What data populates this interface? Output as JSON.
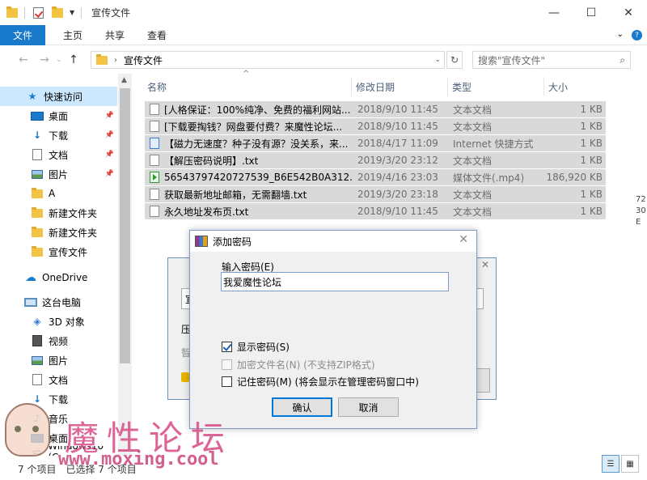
{
  "window": {
    "title": "宣传文件",
    "controls": [
      "—",
      "☐",
      "✕"
    ]
  },
  "ribbon": {
    "tabs": [
      "文件",
      "主页",
      "共享",
      "查看"
    ]
  },
  "address": {
    "path": "宣传文件",
    "search_placeholder": "搜索\"宣传文件\""
  },
  "sidebar": {
    "items": [
      {
        "label": "快速访问",
        "icon": "star-icon"
      },
      {
        "label": "桌面",
        "icon": "desktop-icon",
        "pinned": true
      },
      {
        "label": "下载",
        "icon": "download-icon",
        "pinned": true
      },
      {
        "label": "文档",
        "icon": "document-icon",
        "pinned": true
      },
      {
        "label": "图片",
        "icon": "picture-icon",
        "pinned": true
      },
      {
        "label": "A",
        "icon": "folder-icon"
      },
      {
        "label": "新建文件夹",
        "icon": "folder-icon"
      },
      {
        "label": "新建文件夹",
        "icon": "folder-icon"
      },
      {
        "label": "宣传文件",
        "icon": "folder-icon"
      },
      {
        "label": "OneDrive",
        "icon": "cloud-icon"
      },
      {
        "label": "这台电脑",
        "icon": "pc-icon"
      },
      {
        "label": "3D 对象",
        "icon": "3d-object-icon"
      },
      {
        "label": "视频",
        "icon": "video-icon"
      },
      {
        "label": "图片",
        "icon": "picture-icon"
      },
      {
        "label": "文档",
        "icon": "document-icon"
      },
      {
        "label": "下载",
        "icon": "download-icon"
      },
      {
        "label": "音乐",
        "icon": "music-icon"
      },
      {
        "label": "桌面",
        "icon": "desktop-icon"
      },
      {
        "label": "Windows10 (C:",
        "icon": "drive-icon"
      }
    ]
  },
  "file_list": {
    "columns": [
      "名称",
      "修改日期",
      "类型",
      "大小"
    ],
    "rows": [
      {
        "name": "[人格保证：100%纯净、免费的福利网站...",
        "date": "2018/9/10 11:45",
        "type": "文本文档",
        "size": "1 KB",
        "icon": "text-file-icon"
      },
      {
        "name": "[下载要掏钱？网盘要付费？来魔性论坛...",
        "date": "2018/9/10 11:45",
        "type": "文本文档",
        "size": "1 KB",
        "icon": "text-file-icon"
      },
      {
        "name": "【磁力无速度？种子没有源？没关系，来...",
        "date": "2018/4/17 11:09",
        "type": "Internet 快捷方式",
        "size": "1 KB",
        "icon": "url-shortcut-icon"
      },
      {
        "name": "【解压密码说明】.txt",
        "date": "2019/3/20 23:12",
        "type": "文本文档",
        "size": "1 KB",
        "icon": "text-file-icon"
      },
      {
        "name": "56543797420727539_B6E542B0A312...",
        "date": "2019/4/16 23:03",
        "type": "媒体文件(.mp4)",
        "size": "186,920 KB",
        "icon": "video-file-icon"
      },
      {
        "name": "获取最新地址邮箱，无需翻墙.txt",
        "date": "2019/3/20 23:18",
        "type": "文本文档",
        "size": "1 KB",
        "icon": "text-file-icon"
      },
      {
        "name": "永久地址发布页.txt",
        "date": "2018/9/10 11:45",
        "type": "文本文档",
        "size": "1 KB",
        "icon": "text-file-icon"
      }
    ]
  },
  "status": {
    "text": "7 个项目　已选择 7 个项目"
  },
  "bg_dialog": {
    "field_text": "宣",
    "label_1": "压",
    "label_2": "智"
  },
  "dialog": {
    "title": "添加密码",
    "password_label": "输入密码(E)",
    "password_value": "我爱魔性论坛",
    "show_password": "显示密码(S)",
    "show_password_checked": true,
    "encrypt_names": "加密文件名(N) (不支持ZIP格式)",
    "encrypt_names_checked": false,
    "remember_password": "记住密码(M) (将会显示在管理密码窗口中)",
    "remember_password_checked": false,
    "ok": "确认",
    "cancel": "取消"
  },
  "watermark": {
    "text": "魔性论坛",
    "url": "www.moxing.cool"
  },
  "edge_fragment": "72\n30\nE"
}
